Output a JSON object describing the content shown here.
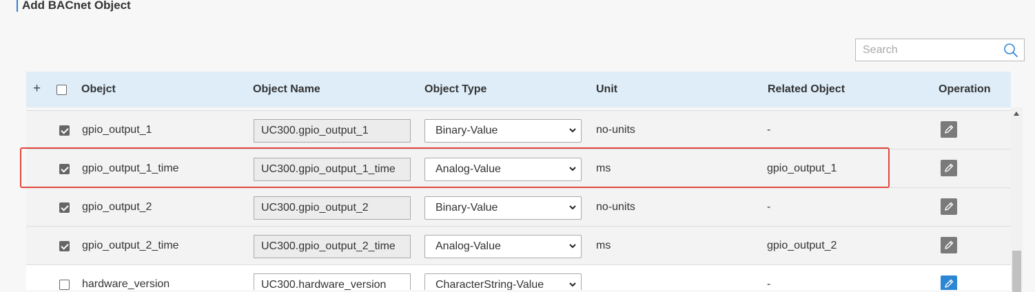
{
  "page": {
    "title": "Add BACnet Object"
  },
  "search": {
    "placeholder": "Search",
    "value": ""
  },
  "table": {
    "headers": {
      "add": "+",
      "object": "Obejct",
      "object_name": "Object Name",
      "object_type": "Object Type",
      "unit": "Unit",
      "related_object": "Related Object",
      "operation": "Operation"
    },
    "rows": [
      {
        "checked": true,
        "object": "gpio_output_1",
        "object_name": "UC300.gpio_output_1",
        "object_type": "Binary-Value",
        "unit": "no-units",
        "related": "-",
        "op_active": false
      },
      {
        "checked": true,
        "object": "gpio_output_1_time",
        "object_name": "UC300.gpio_output_1_time",
        "object_type": "Analog-Value",
        "unit": "ms",
        "related": "gpio_output_1",
        "op_active": false
      },
      {
        "checked": true,
        "object": "gpio_output_2",
        "object_name": "UC300.gpio_output_2",
        "object_type": "Binary-Value",
        "unit": "no-units",
        "related": "-",
        "op_active": false
      },
      {
        "checked": true,
        "object": "gpio_output_2_time",
        "object_name": "UC300.gpio_output_2_time",
        "object_type": "Analog-Value",
        "unit": "ms",
        "related": "gpio_output_2",
        "op_active": false
      },
      {
        "checked": false,
        "object": "hardware_version",
        "object_name": "UC300.hardware_version",
        "object_type": "CharacterString-Value",
        "unit": "",
        "related": "-",
        "op_active": true
      }
    ]
  },
  "colors": {
    "accent": "#2b86d4",
    "highlight": "#e0463c",
    "header_bg": "#deedf8"
  },
  "icons": {
    "search": "search-icon",
    "edit": "pencil-icon",
    "dropdown": "chevron-down-icon"
  }
}
